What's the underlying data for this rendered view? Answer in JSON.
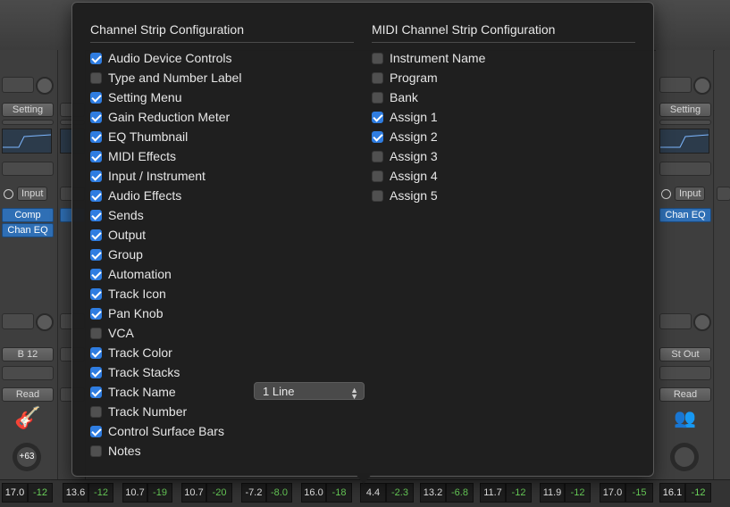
{
  "mixer": {
    "left_strip": {
      "setting_label": "Setting",
      "input_label": "Input",
      "plugins": [
        "Comp",
        "Chan EQ"
      ],
      "output_label": "B 12",
      "automation_label": "Read",
      "pan_value": "+63"
    },
    "right_strip": {
      "setting_label": "Setting",
      "input_label": "Input",
      "plugins": [
        "Chan EQ"
      ],
      "output_label": "St Out",
      "automation_label": "Read"
    },
    "meters": [
      {
        "value": "17.0",
        "green": false
      },
      {
        "value": "-12",
        "green": true
      },
      {
        "value": "13.6",
        "green": false
      },
      {
        "value": "-12",
        "green": true
      },
      {
        "value": "10.7",
        "green": false
      },
      {
        "value": "-19",
        "green": true
      },
      {
        "value": "10.7",
        "green": false
      },
      {
        "value": "-20",
        "green": true
      },
      {
        "value": "-7.2",
        "green": false
      },
      {
        "value": "-8.0",
        "green": true
      },
      {
        "value": "16.0",
        "green": false
      },
      {
        "value": "-18",
        "green": true
      },
      {
        "value": "4.4",
        "green": false
      },
      {
        "value": "-2.3",
        "green": true
      },
      {
        "value": "13.2",
        "green": false
      },
      {
        "value": "-6.8",
        "green": true
      },
      {
        "value": "11.7",
        "green": false
      },
      {
        "value": "-12",
        "green": true
      },
      {
        "value": "11.9",
        "green": false
      },
      {
        "value": "-12",
        "green": true
      },
      {
        "value": "17.0",
        "green": false
      },
      {
        "value": "-15",
        "green": true
      },
      {
        "value": "16.1",
        "green": false
      },
      {
        "value": "-12",
        "green": true
      }
    ]
  },
  "popover": {
    "channel_strip": {
      "title": "Channel Strip Configuration",
      "items": [
        {
          "label": "Audio Device Controls",
          "checked": true
        },
        {
          "label": "Type and Number Label",
          "checked": false
        },
        {
          "label": "Setting Menu",
          "checked": true
        },
        {
          "label": "Gain Reduction Meter",
          "checked": true
        },
        {
          "label": "EQ Thumbnail",
          "checked": true
        },
        {
          "label": "MIDI Effects",
          "checked": true
        },
        {
          "label": "Input / Instrument",
          "checked": true
        },
        {
          "label": "Audio Effects",
          "checked": true
        },
        {
          "label": "Sends",
          "checked": true
        },
        {
          "label": "Output",
          "checked": true
        },
        {
          "label": "Group",
          "checked": true
        },
        {
          "label": "Automation",
          "checked": true
        },
        {
          "label": "Track Icon",
          "checked": true
        },
        {
          "label": "Pan Knob",
          "checked": true
        },
        {
          "label": "VCA",
          "checked": false
        },
        {
          "label": "Track Color",
          "checked": true
        },
        {
          "label": "Track Stacks",
          "checked": true
        },
        {
          "label": "Track Name",
          "checked": true
        },
        {
          "label": "Track Number",
          "checked": false
        },
        {
          "label": "Control Surface Bars",
          "checked": true
        },
        {
          "label": "Notes",
          "checked": false
        }
      ],
      "track_name_lines": "1 Line"
    },
    "midi_strip": {
      "title": "MIDI Channel Strip Configuration",
      "items": [
        {
          "label": "Instrument Name",
          "checked": false
        },
        {
          "label": "Program",
          "checked": false
        },
        {
          "label": "Bank",
          "checked": false
        },
        {
          "label": "Assign 1",
          "checked": true
        },
        {
          "label": "Assign 2",
          "checked": true
        },
        {
          "label": "Assign 3",
          "checked": false
        },
        {
          "label": "Assign 4",
          "checked": false
        },
        {
          "label": "Assign 5",
          "checked": false
        }
      ]
    }
  },
  "colors": {
    "checkbox_accent": "#2f7de1",
    "plugin_blue": "#2f6fb5",
    "meter_green": "#6ad15a"
  }
}
